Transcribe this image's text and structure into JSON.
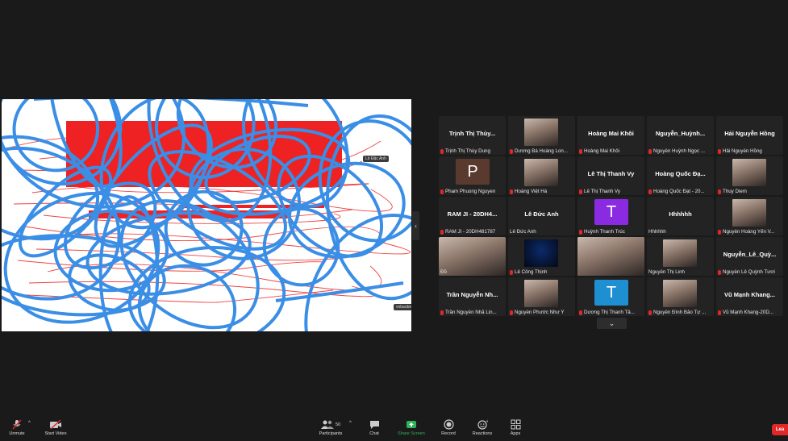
{
  "share": {
    "tag_top": "Lê Đặc Anh",
    "tag_bottom": "vnbaobe"
  },
  "participants": [
    {
      "title": "Trịnh Thị Thùy...",
      "label": "Trịnh Thị Thùy Dung",
      "muted": true
    },
    {
      "title": "",
      "label": "Dương Bá Hoàng Lon...",
      "muted": true,
      "photo": true
    },
    {
      "title": "Hoàng Mai Khôi",
      "label": "Hoàng Mai Khôi",
      "muted": true
    },
    {
      "title": "Nguyễn_Huỳnh...",
      "label": "Nguyễn Huỳnh Ngọc ...",
      "muted": true
    },
    {
      "title": "Hải Nguyễn Hồng",
      "label": "Hải Nguyễn Hồng",
      "muted": true
    },
    {
      "title": "",
      "label": "Pham Phuong Nguyen",
      "muted": true,
      "avatar": "P",
      "avatar_color": "#5a3a2e"
    },
    {
      "title": "",
      "label": "Hoàng Việt Hà",
      "muted": true,
      "photo": true
    },
    {
      "title": "Lê Thị Thanh Vy",
      "label": "Lê Thị Thanh Vy",
      "muted": true
    },
    {
      "title": "Hoàng Quốc Đạ...",
      "label": "Hoàng Quốc Đạt - 20...",
      "muted": true
    },
    {
      "title": "",
      "label": "Thuy Diem",
      "muted": true,
      "photo": true
    },
    {
      "title": "RAM JI - 20DH4...",
      "label": "RAM JI - 20DH481787",
      "muted": true
    },
    {
      "title": "Lê Đức Anh",
      "label": "Lê Đức Anh",
      "muted": false
    },
    {
      "title": "",
      "label": "Huỳnh Thanh Trúc",
      "muted": true,
      "avatar": "T",
      "avatar_color": "#8a2be2"
    },
    {
      "title": "Hhhhhh",
      "label": "Hhhhhh",
      "muted": false
    },
    {
      "title": "",
      "label": "Nguyễn Hoàng Yến V...",
      "muted": true,
      "photo": true
    },
    {
      "title": "",
      "label": "Đồ",
      "muted": false,
      "photo": true,
      "wide": true
    },
    {
      "title": "",
      "label": "Lê Công Thịnh",
      "muted": true,
      "photo": true,
      "dark": true
    },
    {
      "title": "",
      "label": "",
      "muted": false,
      "photo": true,
      "wide": true,
      "active": true
    },
    {
      "title": "",
      "label": "Nguyễn Thị Linh",
      "muted": false,
      "photo": true
    },
    {
      "title": "Nguyễn_Lê_Quỳ...",
      "label": "Nguyễn Lê Quỳnh Tươi",
      "muted": true
    },
    {
      "title": "Trần Nguyễn Nh...",
      "label": "Trần Nguyễn Nhã Lin...",
      "muted": true
    },
    {
      "title": "",
      "label": "Nguyễn Phước Như Ý",
      "muted": true,
      "photo": true
    },
    {
      "title": "",
      "label": "Dương Thị Thanh Tâ...",
      "muted": true,
      "avatar": "T",
      "avatar_color": "#1e8fd0"
    },
    {
      "title": "",
      "label": "Nguyễn Đình Bảo Tự ...",
      "muted": true,
      "photo": true
    },
    {
      "title": "Vũ Mạnh Khang...",
      "label": "Vũ Mạnh Khang-20D...",
      "muted": true
    }
  ],
  "toolbar": {
    "unmute": "Unmute",
    "start_video": "Start Video",
    "participants": "Participants",
    "participants_count": "50",
    "chat": "Chat",
    "share_screen": "Share Screen",
    "record": "Record",
    "reactions": "Reactions",
    "apps": "Apps",
    "leave": "Lea"
  },
  "colors": {
    "share_screen_green": "#2fb35a",
    "muted_red": "#e02828",
    "active_speaker": "#b4d85c",
    "scribble_blue": "#3a8ee6",
    "scribble_red": "#ee2222"
  }
}
